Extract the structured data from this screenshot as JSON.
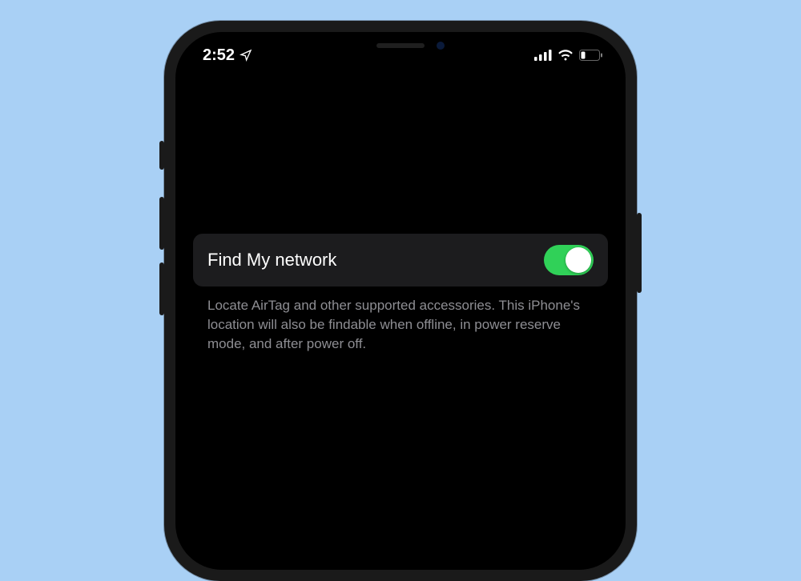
{
  "statusBar": {
    "time": "2:52"
  },
  "setting": {
    "label": "Find My network",
    "toggleOn": true,
    "description": "Locate AirTag and other supported accessories. This iPhone's location will also be findable when offline, in power reserve mode, and after power off."
  }
}
